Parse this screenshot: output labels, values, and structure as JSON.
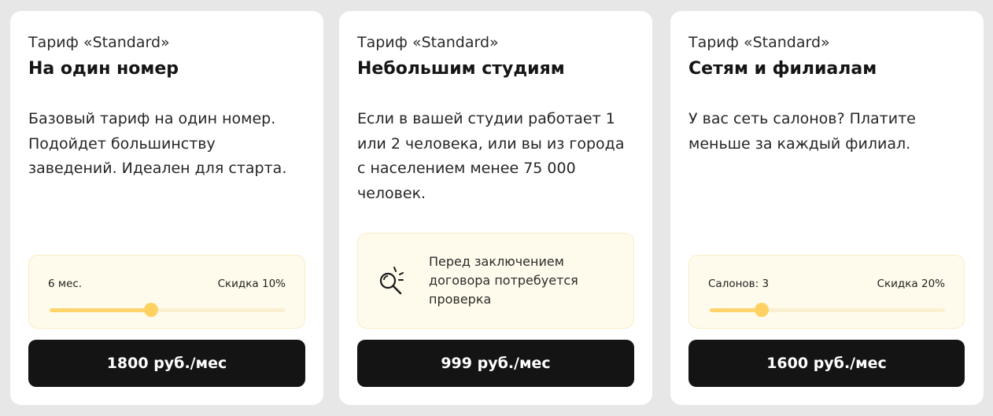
{
  "cards": [
    {
      "kicker": "Тариф «Standard»",
      "title": "На один номер",
      "description": "Базовый тариф на один номер. Подойдет большинству заведений. Идеален для старта.",
      "slider": {
        "left_label": "6 мес.",
        "right_label": "Скидка 10%",
        "level_percent": 43
      },
      "price_label": "1800 руб./мес"
    },
    {
      "kicker": "Тариф «Standard»",
      "title": "Небольшим студиям",
      "description": "Если в вашей студии работает 1 или 2 человека, или вы из города с населением менее 75 000 человек.",
      "info": {
        "icon": "magnifier-icon",
        "text": "Перед заключением договора потребуется проверка"
      },
      "price_label": "999 руб./мес"
    },
    {
      "kicker": "Тариф «Standard»",
      "title": "Сетям и филиалам",
      "description": "У вас сеть салонов? Платите меньше за каждый филиал.",
      "slider": {
        "left_label": "Салонов: 3",
        "right_label": "Скидка 20%",
        "level_percent": 22
      },
      "price_label": "1600 руб./мес"
    }
  ],
  "colors": {
    "background": "#e7e7e7",
    "card": "#ffffff",
    "panel": "#fffbec",
    "slider_fill": "#ffd46b",
    "button": "#141414"
  }
}
